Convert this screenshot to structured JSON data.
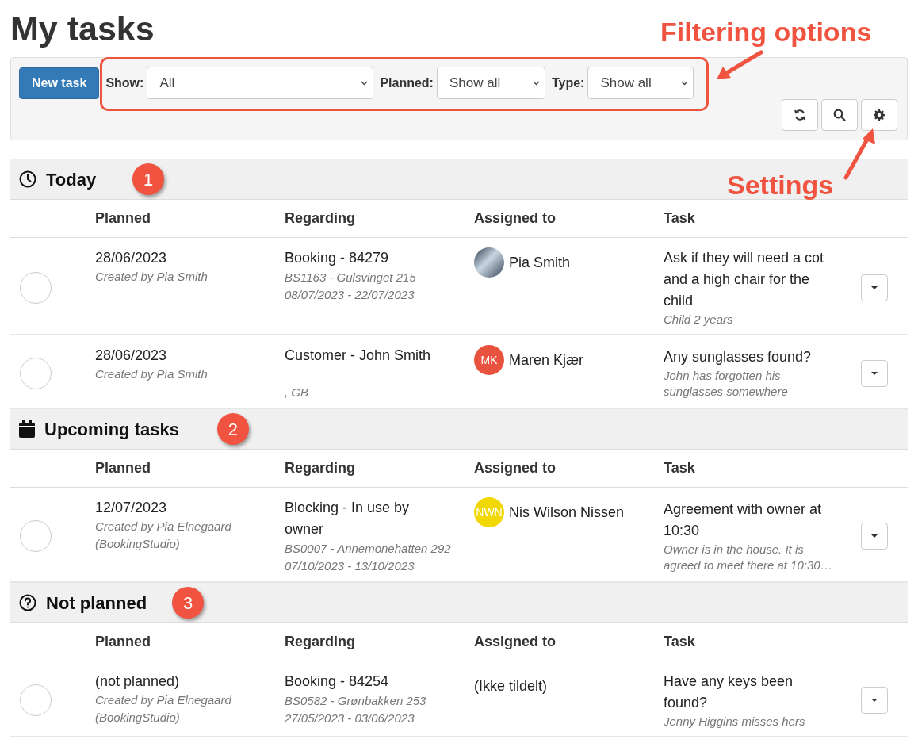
{
  "title": "My tasks",
  "toolbar": {
    "new_task": "New task",
    "filters": [
      {
        "label": "Show:",
        "value": "All"
      },
      {
        "label": "Planned:",
        "value": "Show all"
      },
      {
        "label": "Type:",
        "value": "Show all"
      }
    ]
  },
  "sections": [
    {
      "kind": "clock",
      "title": "Today",
      "badge": "1",
      "columns": [
        "Planned",
        "Regarding",
        "Assigned to",
        "Task"
      ],
      "tasks": [
        {
          "planned": "28/06/2023",
          "created_by": "Created by Pia Smith",
          "regarding": "Booking - 84279",
          "regarding_details": [
            "BS1163 - Gulsvinget 215",
            "08/07/2023 - 22/07/2023"
          ],
          "assignee": {
            "kind": "photo",
            "name": "Pia Smith"
          },
          "task": "Ask if they will need a cot and a high chair for the child",
          "note": "Child 2 years",
          "done": false
        },
        {
          "planned": "28/06/2023",
          "created_by": "Created by Pia Smith",
          "regarding": "Customer - John Smith",
          "regarding_details": [
            ", GB"
          ],
          "assignee": {
            "kind": "initials",
            "initials": "MK",
            "color": "#e8533f",
            "name": "Maren Kjær"
          },
          "task": "Any sunglasses found?",
          "note": "John has forgotten his sunglasses somewhere",
          "done": false
        }
      ]
    },
    {
      "kind": "calendar",
      "title": "Upcoming tasks",
      "badge": "2",
      "columns": [
        "Planned",
        "Regarding",
        "Assigned to",
        "Task"
      ],
      "tasks": [
        {
          "planned": "12/07/2023",
          "created_by": "Created by Pia Elnegaard (BookingStudio)",
          "regarding": "Blocking - In use by owner",
          "regarding_details": [
            "BS0007 - Annemonehatten 292",
            "07/10/2023 - 13/10/2023"
          ],
          "assignee": {
            "kind": "initials",
            "initials": "NWN",
            "color": "#f0d800",
            "name": "Nis Wilson Nissen"
          },
          "task": "Agreement with owner at 10:30",
          "note": "Owner is in the house. It is agreed to meet there at 10:30…",
          "done": false
        }
      ]
    },
    {
      "kind": "question",
      "title": "Not planned",
      "badge": "3",
      "columns": [
        "Planned",
        "Regarding",
        "Assigned to",
        "Task"
      ],
      "tasks": [
        {
          "planned": "(not planned)",
          "created_by": "Created by Pia Elnegaard (BookingStudio)",
          "regarding": "Booking - 84254",
          "regarding_details": [
            "BS0582 - Grønbakken 253",
            "27/05/2023 - 03/06/2023"
          ],
          "assignee": {
            "kind": "none",
            "name": "(Ikke tildelt)"
          },
          "task": "Have any keys been found?",
          "note": "Jenny Higgins misses hers",
          "done": false
        }
      ]
    }
  ],
  "annotations": {
    "filtering": "Filtering options",
    "settings": "Settings"
  }
}
